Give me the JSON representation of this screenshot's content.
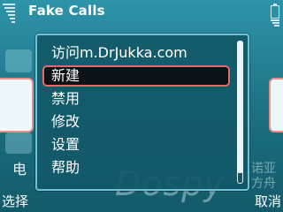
{
  "app": {
    "title": "Fake Calls"
  },
  "background": {
    "label": "电"
  },
  "menu": {
    "items": [
      {
        "label": "访问m.DrJukka.com"
      },
      {
        "label": "新建"
      },
      {
        "label": "禁用"
      },
      {
        "label": "修改"
      },
      {
        "label": "设置"
      },
      {
        "label": "帮助"
      }
    ],
    "selected_label": "新建"
  },
  "watermark": {
    "main": "Dospy",
    "side": "诺亚方舟"
  },
  "softkeys": {
    "left": "选择",
    "right": "取消"
  },
  "colors": {
    "accent": "#6ec2d6",
    "highlight_border": "#e46a6a",
    "background": "#1c6f80"
  }
}
